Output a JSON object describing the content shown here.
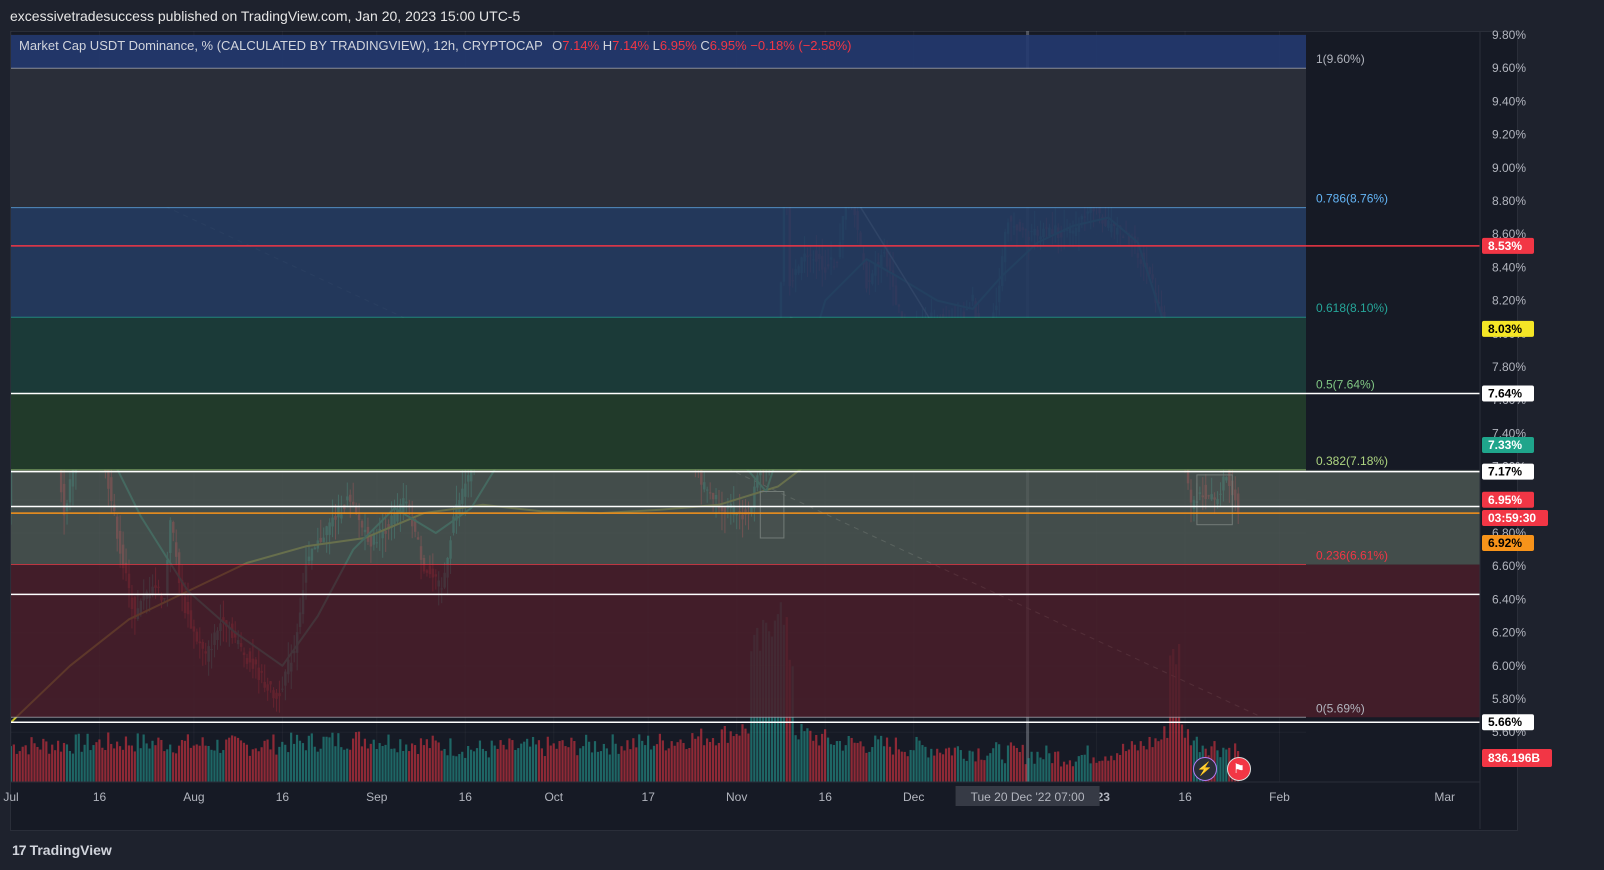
{
  "header": {
    "publisher": "excessivetradesuccess published on TradingView.com, Jan 20, 2023 15:00 UTC-5"
  },
  "legend": {
    "symbol": "Market Cap USDT Dominance, % (CALCULATED BY TRADINGVIEW), 12h, CRYPTOCAP",
    "o_label": "O",
    "o_value": "7.14%",
    "h_label": "H",
    "h_value": "7.14%",
    "l_label": "L",
    "l_value": "6.95%",
    "c_label": "C",
    "c_value": "6.95%",
    "change": "−0.18% (−2.58%)"
  },
  "footer": {
    "brand": "TradingView"
  },
  "colors": {
    "bg": "#161a25",
    "up": "#26a69a",
    "down": "#f23645",
    "ema_fast": "#1fa58b",
    "ema_slow": "#c8c12a",
    "fib_line": "#ffffff"
  },
  "icons": {
    "flash": "lightning-icon",
    "flag": "us-flag-icon"
  },
  "chart_data": {
    "type": "candlestick",
    "title": "",
    "xlabel": "",
    "ylabel": "",
    "ylim": [
      5.5,
      9.8
    ],
    "y_ticks": [
      "9.80%",
      "9.60%",
      "9.40%",
      "9.20%",
      "9.00%",
      "8.80%",
      "8.60%",
      "8.40%",
      "8.20%",
      "8.00%",
      "7.80%",
      "7.60%",
      "7.40%",
      "7.20%",
      "7.00%",
      "6.80%",
      "6.60%",
      "6.40%",
      "6.20%",
      "6.00%",
      "5.80%",
      "5.60%"
    ],
    "x_ticks": [
      "Jul",
      "16",
      "Aug",
      "16",
      "Sep",
      "16",
      "Oct",
      "17",
      "Nov",
      "16",
      "Dec",
      "2023",
      "16",
      "Feb",
      "Mar"
    ],
    "x_ticks_time": [
      0,
      15,
      31,
      46,
      62,
      77,
      92,
      108,
      123,
      138,
      153,
      184,
      199,
      215,
      243
    ],
    "crosshair_label": "Tue 20 Dec '22   07:00",
    "crosshair_time": 172.3,
    "price_path": [
      [
        0,
        7.9
      ],
      [
        3,
        7.7
      ],
      [
        7,
        7.6
      ],
      [
        9,
        6.9
      ],
      [
        12,
        7.5
      ],
      [
        14,
        7.8
      ],
      [
        16,
        7.2
      ],
      [
        19,
        6.6
      ],
      [
        21,
        6.3
      ],
      [
        24,
        6.5
      ],
      [
        26,
        6.4
      ],
      [
        27,
        6.9
      ],
      [
        29,
        6.4
      ],
      [
        31,
        6.2
      ],
      [
        33,
        6.05
      ],
      [
        36,
        6.3
      ],
      [
        39,
        6.1
      ],
      [
        42,
        5.95
      ],
      [
        45,
        5.8
      ],
      [
        48,
        6.1
      ],
      [
        50,
        6.6
      ],
      [
        53,
        6.8
      ],
      [
        57,
        7.0
      ],
      [
        61,
        6.75
      ],
      [
        64,
        6.85
      ],
      [
        67,
        7.0
      ],
      [
        70,
        6.6
      ],
      [
        73,
        6.45
      ],
      [
        75,
        6.9
      ],
      [
        78,
        7.2
      ],
      [
        82,
        7.5
      ],
      [
        85,
        7.3
      ],
      [
        89,
        7.65
      ],
      [
        92,
        7.5
      ],
      [
        96,
        7.3
      ],
      [
        100,
        7.55
      ],
      [
        103,
        7.8
      ],
      [
        106,
        7.6
      ],
      [
        109,
        7.9
      ],
      [
        112,
        7.7
      ],
      [
        114,
        7.6
      ],
      [
        117,
        7.1
      ],
      [
        121,
        6.95
      ],
      [
        125,
        6.9
      ],
      [
        127,
        7.2
      ],
      [
        130,
        7.3
      ],
      [
        131,
        9.3
      ],
      [
        132,
        8.3
      ],
      [
        135,
        8.5
      ],
      [
        138,
        8.4
      ],
      [
        140,
        8.45
      ],
      [
        142,
        8.9
      ],
      [
        145,
        8.3
      ],
      [
        148,
        8.5
      ],
      [
        150,
        8.2
      ],
      [
        152,
        7.95
      ],
      [
        156,
        8.1
      ],
      [
        160,
        8.05
      ],
      [
        163,
        8.2
      ],
      [
        165,
        7.9
      ],
      [
        167,
        8.2
      ],
      [
        169,
        8.7
      ],
      [
        172,
        8.6
      ],
      [
        176,
        8.62
      ],
      [
        180,
        8.6
      ],
      [
        183,
        8.8
      ],
      [
        186,
        8.65
      ],
      [
        190,
        8.55
      ],
      [
        193,
        8.35
      ],
      [
        195,
        8.1
      ],
      [
        197,
        7.7
      ],
      [
        199,
        7.2
      ],
      [
        200,
        6.95
      ],
      [
        202,
        7.05
      ],
      [
        204,
        6.98
      ],
      [
        206,
        7.15
      ],
      [
        208,
        6.95
      ]
    ],
    "ema_fast": [
      [
        0,
        7.5
      ],
      [
        8,
        7.6
      ],
      [
        15,
        7.4
      ],
      [
        22,
        6.9
      ],
      [
        30,
        6.45
      ],
      [
        38,
        6.2
      ],
      [
        46,
        6.0
      ],
      [
        52,
        6.3
      ],
      [
        58,
        6.7
      ],
      [
        65,
        6.95
      ],
      [
        72,
        6.8
      ],
      [
        78,
        6.95
      ],
      [
        84,
        7.3
      ],
      [
        92,
        7.4
      ],
      [
        100,
        7.5
      ],
      [
        108,
        7.65
      ],
      [
        115,
        7.6
      ],
      [
        122,
        7.3
      ],
      [
        128,
        7.05
      ],
      [
        133,
        7.6
      ],
      [
        138,
        8.2
      ],
      [
        145,
        8.45
      ],
      [
        150,
        8.35
      ],
      [
        157,
        8.2
      ],
      [
        163,
        8.15
      ],
      [
        168,
        8.35
      ],
      [
        174,
        8.55
      ],
      [
        180,
        8.65
      ],
      [
        186,
        8.7
      ],
      [
        191,
        8.55
      ],
      [
        196,
        8.0
      ],
      [
        200,
        7.6
      ],
      [
        203,
        7.3
      ]
    ],
    "ema_slow": [
      [
        0,
        5.66
      ],
      [
        10,
        6.0
      ],
      [
        20,
        6.28
      ],
      [
        30,
        6.45
      ],
      [
        40,
        6.62
      ],
      [
        50,
        6.72
      ],
      [
        60,
        6.77
      ],
      [
        70,
        6.92
      ],
      [
        80,
        6.97
      ],
      [
        90,
        6.93
      ],
      [
        100,
        6.92
      ],
      [
        110,
        6.94
      ],
      [
        120,
        6.97
      ],
      [
        130,
        7.08
      ],
      [
        140,
        7.35
      ],
      [
        150,
        7.48
      ],
      [
        160,
        7.57
      ],
      [
        170,
        7.68
      ],
      [
        180,
        7.85
      ],
      [
        190,
        8.0
      ],
      [
        196,
        8.06
      ],
      [
        203,
        8.03
      ]
    ],
    "fib_levels": [
      {
        "ratio": "1",
        "value": 9.6,
        "label": "1(9.60%)",
        "color": "#b2b5be"
      },
      {
        "ratio": "0.786",
        "value": 8.76,
        "label": "0.786(8.76%)",
        "color": "#64b5f6"
      },
      {
        "ratio": "0.618",
        "value": 8.1,
        "label": "0.618(8.10%)",
        "color": "#26a69a"
      },
      {
        "ratio": "0.5",
        "value": 7.64,
        "label": "0.5(7.64%)",
        "color": "#81c784"
      },
      {
        "ratio": "0.382",
        "value": 7.18,
        "label": "0.382(7.18%)",
        "color": "#aed581"
      },
      {
        "ratio": "0.236",
        "value": 6.61,
        "label": "0.236(6.61%)",
        "color": "#f23645"
      },
      {
        "ratio": "0",
        "value": 5.69,
        "label": "0(5.69%)",
        "color": "#b2b5be"
      }
    ],
    "horizontal_lines": [
      {
        "value": 8.53,
        "color": "#f23645"
      },
      {
        "value": 7.64,
        "color": "#ffffff"
      },
      {
        "value": 7.17,
        "color": "#ffffff"
      },
      {
        "value": 6.96,
        "color": "#ffffff"
      },
      {
        "value": 6.92,
        "color": "#f7931a"
      },
      {
        "value": 6.43,
        "color": "#ffffff"
      },
      {
        "value": 5.66,
        "color": "#ffffff"
      }
    ],
    "price_tags": [
      {
        "text": "8.53%",
        "value": 8.53,
        "bg": "#f23645",
        "fg": "#ffffff"
      },
      {
        "text": "8.03%",
        "value": 8.03,
        "bg": "#f5e626",
        "fg": "#000000"
      },
      {
        "text": "7.64%",
        "value": 7.64,
        "bg": "#ffffff",
        "fg": "#000000"
      },
      {
        "text": "7.33%",
        "value": 7.33,
        "bg": "#1fa58b",
        "fg": "#ffffff"
      },
      {
        "text": "7.17%",
        "value": 7.17,
        "bg": "#ffffff",
        "fg": "#000000"
      },
      {
        "text": "6.95%",
        "value": 7.0,
        "bg": "#f23645",
        "fg": "#ffffff"
      },
      {
        "text": "03:59:30",
        "value": 6.89,
        "bg": "#f23645",
        "fg": "#ffffff"
      },
      {
        "text": "6.92%",
        "value": 6.74,
        "bg": "#f7931a",
        "fg": "#000000"
      },
      {
        "text": "5.66%",
        "value": 5.66,
        "bg": "#ffffff",
        "fg": "#000000"
      }
    ],
    "volume_tag": "836.196B",
    "volume_profile": [
      [
        0,
        0.35
      ],
      [
        20,
        0.4
      ],
      [
        40,
        0.35
      ],
      [
        60,
        0.45
      ],
      [
        80,
        0.3
      ],
      [
        95,
        0.35
      ],
      [
        110,
        0.4
      ],
      [
        120,
        0.5
      ],
      [
        125,
        0.6
      ],
      [
        128,
        0.75
      ],
      [
        130,
        1.0
      ],
      [
        131,
        0.8
      ],
      [
        133,
        0.55
      ],
      [
        140,
        0.4
      ],
      [
        150,
        0.35
      ],
      [
        160,
        0.3
      ],
      [
        170,
        0.25
      ],
      [
        180,
        0.2
      ],
      [
        190,
        0.3
      ],
      [
        195,
        0.45
      ],
      [
        197,
        0.7
      ],
      [
        199,
        0.55
      ],
      [
        201,
        0.4
      ],
      [
        207,
        0.3
      ]
    ],
    "trend_lines": [
      {
        "name": "descending-resistance",
        "from": [
          132,
          9.45
        ],
        "to": [
          162,
          7.73
        ],
        "color": "#ffffff"
      },
      {
        "name": "support-line",
        "from": [
          132,
          8.1
        ],
        "to": [
          162,
          7.78
        ],
        "color": "#ffffff"
      },
      {
        "name": "long-dashed-trend",
        "from": [
          0,
          9.2
        ],
        "to": [
          212,
          5.69
        ],
        "color": "#888888"
      }
    ],
    "boxes": [
      {
        "name": "nov-low-box",
        "t1": 127,
        "t2": 131,
        "v1": 7.05,
        "v2": 6.77
      },
      {
        "name": "jan-low-box",
        "t1": 201,
        "t2": 207,
        "v1": 7.15,
        "v2": 6.85
      }
    ]
  }
}
